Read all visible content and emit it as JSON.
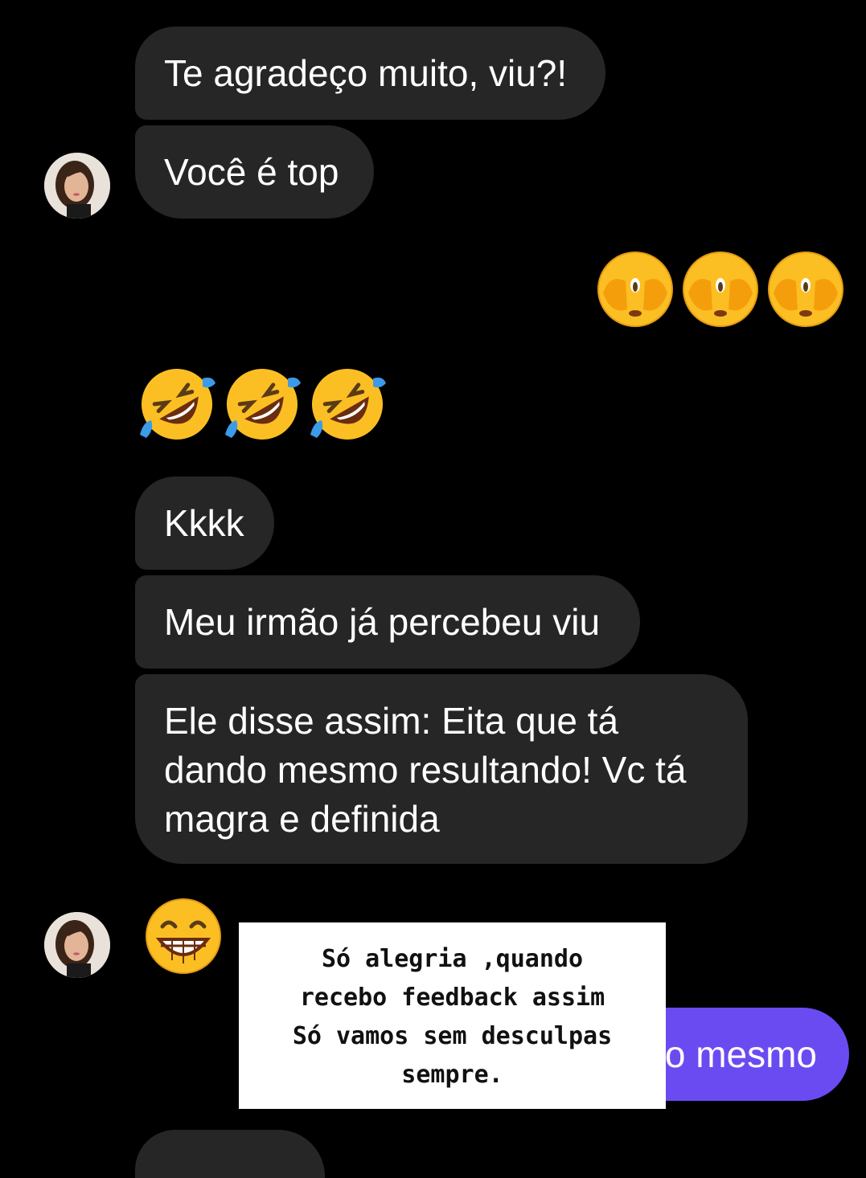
{
  "messages": {
    "m1": "Te agradeço muito, viu?!",
    "m2": "Você é top",
    "m3": "Kkkk",
    "m4": "Meu irmão já percebeu viu",
    "m5_line1": "Ele disse assim: Eita que tá",
    "m5_line2": "dando mesmo resultando! Vc tá",
    "m5_line3": "magra e definida",
    "sent_partial": "o mesmo"
  },
  "emojis": {
    "sent_row": "see-no-evil-face x3",
    "received_row": "rolling-on-floor-laughing x3",
    "last": "beaming-face"
  },
  "overlay": {
    "line1": "Só alegria ,quando",
    "line2": "recebo feedback assim",
    "line3": "Só vamos sem desculpas",
    "line4": "sempre."
  },
  "colors": {
    "background": "#000000",
    "received_bubble": "#262626",
    "sent_bubble": "#6a4bf2"
  }
}
